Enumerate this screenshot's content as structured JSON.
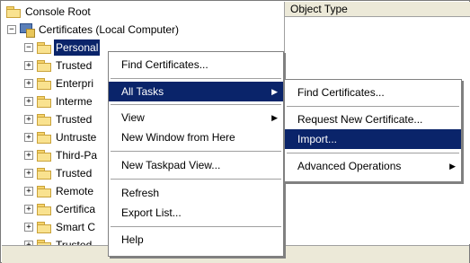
{
  "tree": {
    "root": "Console Root",
    "computer": "Certificates (Local Computer)",
    "items": [
      {
        "label": "Personal",
        "expander": "−",
        "selected": true
      },
      {
        "label": "Trusted",
        "expander": "+"
      },
      {
        "label": "Enterpri",
        "expander": "+"
      },
      {
        "label": "Interme",
        "expander": "+"
      },
      {
        "label": "Trusted",
        "expander": "+"
      },
      {
        "label": "Untruste",
        "expander": "+"
      },
      {
        "label": "Third-Pa",
        "expander": "+"
      },
      {
        "label": "Trusted",
        "expander": "+"
      },
      {
        "label": "Remote",
        "expander": "+"
      },
      {
        "label": "Certifica",
        "expander": "+"
      },
      {
        "label": "Smart C",
        "expander": "+"
      },
      {
        "label": "Trusted",
        "expander": "+"
      }
    ],
    "computer_expander": "−"
  },
  "right_pane": {
    "column_header": "Object Type"
  },
  "context_menu": {
    "find_certificates": "Find Certificates...",
    "all_tasks": "All Tasks",
    "view": "View",
    "new_window": "New Window from Here",
    "new_taskpad": "New Taskpad View...",
    "refresh": "Refresh",
    "export_list": "Export List...",
    "help": "Help",
    "arrow": "▶"
  },
  "submenu": {
    "find_certificates": "Find Certificates...",
    "request_new": "Request New Certificate...",
    "import": "Import...",
    "advanced": "Advanced Operations",
    "arrow": "▶"
  },
  "colors": {
    "highlight": "#0a246a",
    "folder": "#f9e28f"
  }
}
